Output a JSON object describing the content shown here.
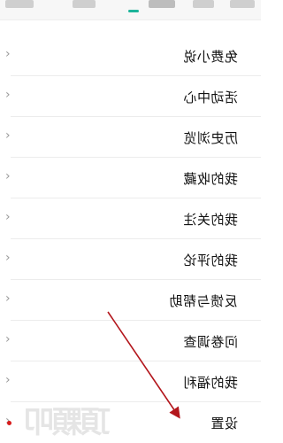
{
  "tabs": [
    {
      "id": "tab-1"
    },
    {
      "id": "tab-2"
    },
    {
      "id": "tab-3"
    },
    {
      "id": "tab-4"
    },
    {
      "id": "tab-5"
    }
  ],
  "colors": {
    "accent": "#1db49a",
    "arrow": "#b3161c",
    "watermark_dot": "#d81b1b"
  },
  "menu": {
    "items": [
      {
        "label": "免费小说"
      },
      {
        "label": "活动中心"
      },
      {
        "label": "历史浏览"
      },
      {
        "label": "我的收藏"
      },
      {
        "label": "我的关注"
      },
      {
        "label": "我的评论"
      },
      {
        "label": "反馈与帮助"
      },
      {
        "label": "问卷调查"
      },
      {
        "label": "我的福利"
      },
      {
        "label": "设置"
      }
    ],
    "chevron_icon": "chevron-right-icon"
  },
  "watermark": {
    "text": "頂顆叩"
  }
}
